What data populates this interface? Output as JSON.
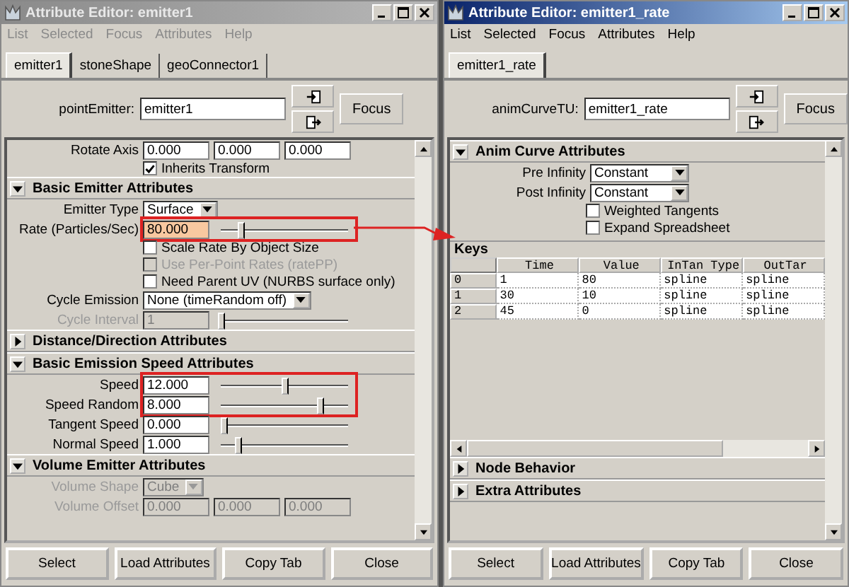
{
  "windows": [
    {
      "title": "Attribute Editor: emitter1",
      "active": false,
      "menu": [
        "List",
        "Selected",
        "Focus",
        "Attributes",
        "Help"
      ],
      "tabs": [
        {
          "label": "emitter1",
          "selected": true
        },
        {
          "label": "stoneShape",
          "selected": false
        },
        {
          "label": "geoConnector1",
          "selected": false
        }
      ],
      "node": {
        "label": "pointEmitter:",
        "value": "emitter1"
      },
      "focus": "Focus",
      "sections": [
        {
          "items": [
            {
              "kind": "triple",
              "label": "Rotate Axis",
              "values": [
                "0.000",
                "0.000",
                "0.000"
              ],
              "disabled": false
            },
            {
              "kind": "checkbox",
              "label": "Inherits Transform",
              "checked": true,
              "disabled": false
            }
          ]
        },
        {
          "title": "Basic Emitter Attributes",
          "expanded": true,
          "items": [
            {
              "kind": "dropdown",
              "label": "Emitter Type",
              "value": "Surface",
              "disabled": false
            },
            {
              "kind": "slider",
              "label": "Rate (Particles/Sec)",
              "value": "80.000",
              "level": 0.15,
              "keyed": true,
              "highlighted": true,
              "disabled": false
            },
            {
              "kind": "checkbox",
              "label": "Scale Rate By Object Size",
              "checked": false,
              "disabled": false
            },
            {
              "kind": "checkbox",
              "label": "Use Per-Point Rates (ratePP)",
              "checked": false,
              "disabled": true
            },
            {
              "kind": "checkbox",
              "label": "Need Parent UV (NURBS surface only)",
              "checked": false,
              "disabled": false
            },
            {
              "kind": "dropdown",
              "label": "Cycle Emission",
              "value": "None (timeRandom off)",
              "disabled": false
            },
            {
              "kind": "slider",
              "label": "Cycle Interval",
              "value": "1",
              "level": 0.0,
              "disabled": true
            }
          ]
        },
        {
          "title": "Distance/Direction Attributes",
          "expanded": false
        },
        {
          "title": "Basic Emission Speed Attributes",
          "expanded": true,
          "items": [
            {
              "kind": "slider",
              "label": "Speed",
              "value": "12.000",
              "level": 0.5,
              "highlighted": true,
              "disabled": false
            },
            {
              "kind": "slider",
              "label": "Speed Random",
              "value": "8.000",
              "level": 0.78,
              "highlighted": true,
              "disabled": false
            },
            {
              "kind": "slider",
              "label": "Tangent Speed",
              "value": "0.000",
              "level": 0.02,
              "disabled": false
            },
            {
              "kind": "slider",
              "label": "Normal Speed",
              "value": "1.000",
              "level": 0.13,
              "disabled": false
            }
          ]
        },
        {
          "title": "Volume Emitter Attributes",
          "expanded": true,
          "items": [
            {
              "kind": "dropdown",
              "label": "Volume Shape",
              "value": "Cube",
              "disabled": true
            },
            {
              "kind": "triple",
              "label": "Volume Offset",
              "values": [
                "0.000",
                "0.000",
                "0.000"
              ],
              "disabled": true
            }
          ]
        }
      ],
      "buttons": [
        "Select",
        "Load Attributes",
        "Copy Tab",
        "Close"
      ]
    },
    {
      "title": "Attribute Editor: emitter1_rate",
      "active": true,
      "menu": [
        "List",
        "Selected",
        "Focus",
        "Attributes",
        "Help"
      ],
      "tabs": [
        {
          "label": "emitter1_rate",
          "selected": true
        }
      ],
      "node": {
        "label": "animCurveTU:",
        "value": "emitter1_rate"
      },
      "focus": "Focus",
      "sections": [
        {
          "title": "Anim Curve Attributes",
          "expanded": true,
          "items": [
            {
              "kind": "dropdown",
              "label": "Pre Infinity",
              "value": "Constant",
              "disabled": false
            },
            {
              "kind": "dropdown",
              "label": "Post Infinity",
              "value": "Constant",
              "disabled": false
            },
            {
              "kind": "checkbox",
              "label": "Weighted Tangents",
              "checked": false,
              "disabled": false
            },
            {
              "kind": "checkbox",
              "label": "Expand Spreadsheet",
              "checked": false,
              "disabled": false
            },
            {
              "kind": "table",
              "label": "Keys",
              "columns": [
                "Time",
                "Value",
                "InTan Type",
                "OutTar"
              ],
              "rows": [
                {
                  "index": "0",
                  "cells": [
                    "1",
                    "80",
                    "spline",
                    "spline"
                  ]
                },
                {
                  "index": "1",
                  "cells": [
                    "30",
                    "10",
                    "spline",
                    "spline"
                  ]
                },
                {
                  "index": "2",
                  "cells": [
                    "45",
                    "0",
                    "spline",
                    "spline"
                  ]
                }
              ]
            }
          ]
        },
        {
          "title": "Node Behavior",
          "expanded": false
        },
        {
          "title": "Extra Attributes",
          "expanded": false
        }
      ],
      "buttons": [
        "Select",
        "Load Attributes",
        "Copy Tab",
        "Close"
      ]
    }
  ]
}
